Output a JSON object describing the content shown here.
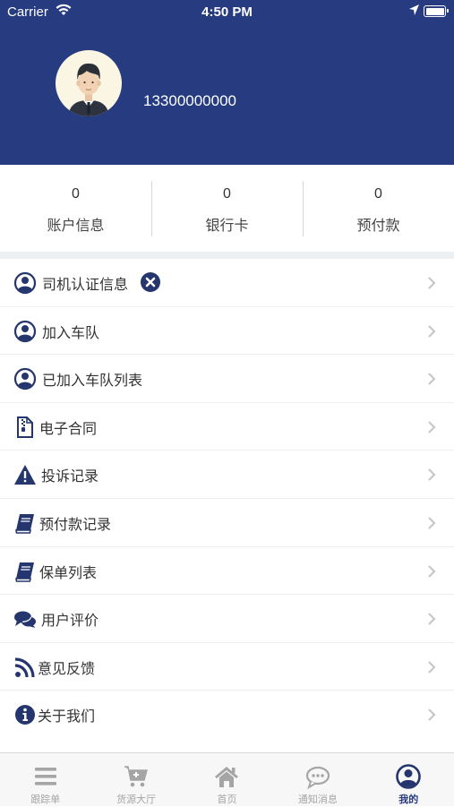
{
  "status_bar": {
    "carrier": "Carrier",
    "time": "4:50 PM"
  },
  "profile": {
    "phone": "13300000000"
  },
  "stats": [
    {
      "value": "0",
      "label": "账户信息"
    },
    {
      "value": "0",
      "label": "银行卡"
    },
    {
      "value": "0",
      "label": "预付款"
    }
  ],
  "menu": [
    {
      "label": "司机认证信息",
      "icon": "user-circle-icon"
    },
    {
      "label": "加入车队",
      "icon": "user-circle-icon"
    },
    {
      "label": "已加入车队列表",
      "icon": "user-circle-icon"
    },
    {
      "label": "电子合同",
      "icon": "document-zip-icon"
    },
    {
      "label": "投诉记录",
      "icon": "warning-icon"
    },
    {
      "label": "预付款记录",
      "icon": "book-icon"
    },
    {
      "label": "保单列表",
      "icon": "book-icon"
    },
    {
      "label": "用户评价",
      "icon": "comments-icon"
    },
    {
      "label": "意见反馈",
      "icon": "rss-icon"
    },
    {
      "label": "关于我们",
      "icon": "info-circle-icon"
    }
  ],
  "tabs": [
    {
      "label": "跟踪单",
      "icon": "list-icon"
    },
    {
      "label": "货源大厅",
      "icon": "cart-plus-icon"
    },
    {
      "label": "首页",
      "icon": "home-icon"
    },
    {
      "label": "通知消息",
      "icon": "chat-icon"
    },
    {
      "label": "我的",
      "icon": "user-circle-icon",
      "active": true
    }
  ],
  "colors": {
    "brand": "#263b80",
    "icon": "#25366e",
    "badge": "#25366e",
    "tab_inactive": "#a5a5a5"
  }
}
